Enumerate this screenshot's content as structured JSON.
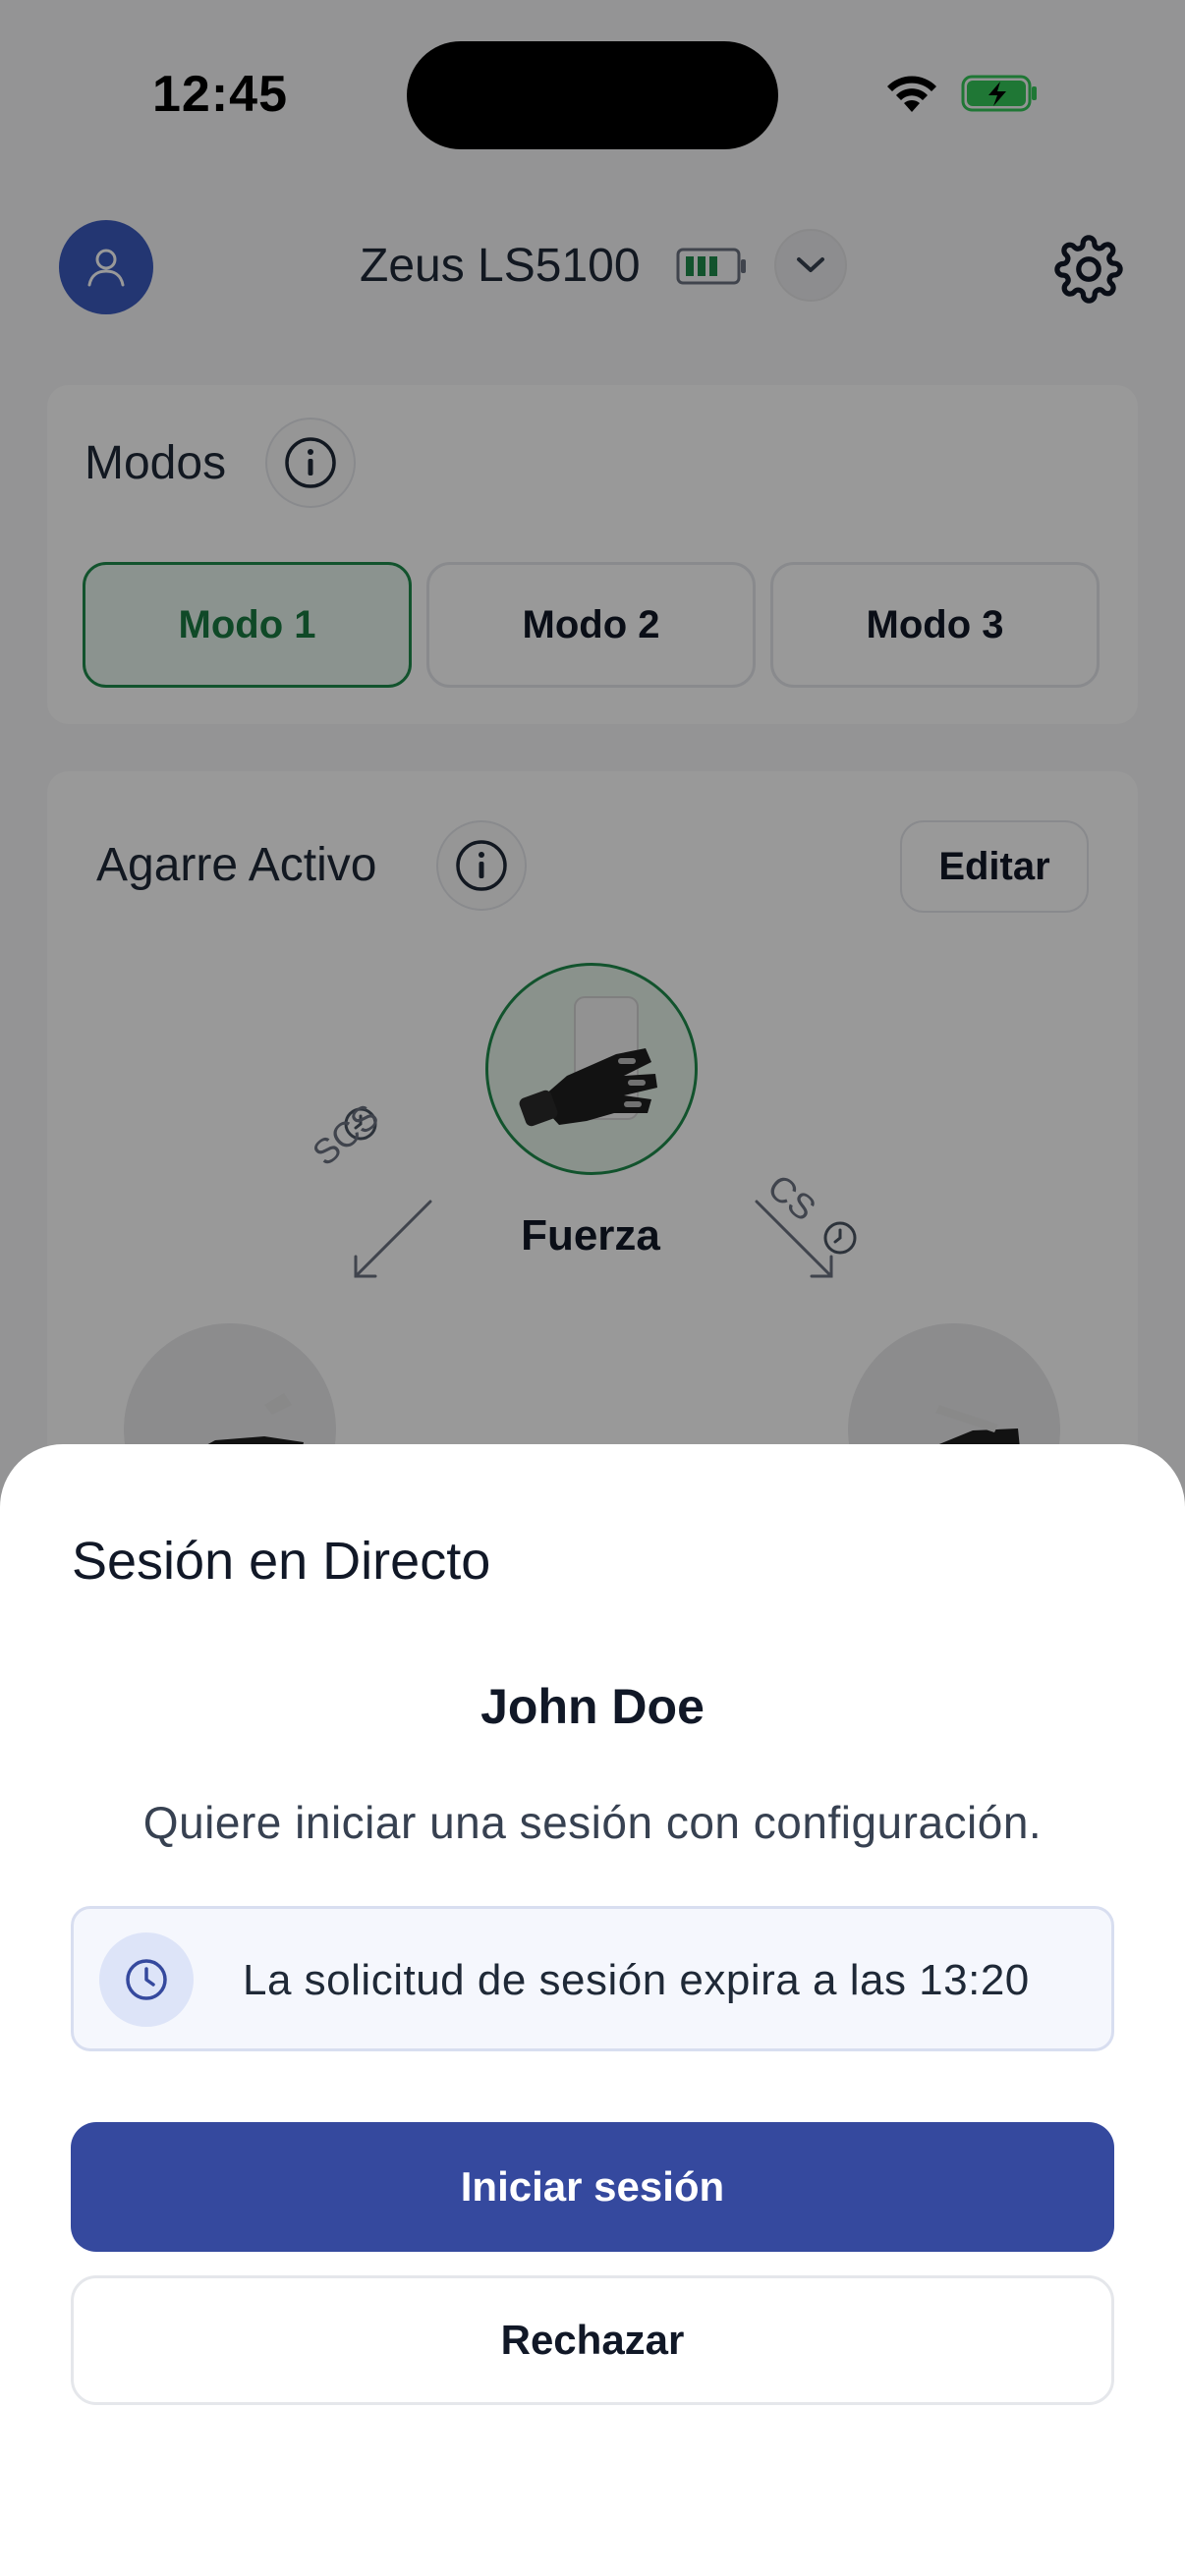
{
  "status_bar": {
    "time": "12:45",
    "wifi_icon": "wifi-icon",
    "battery_icon": "battery-charging-icon"
  },
  "header": {
    "device_name": "Zeus LS5100",
    "avatar_icon": "user-icon",
    "device_battery_icon": "battery-icon",
    "dropdown_icon": "chevron-down-icon",
    "settings_icon": "gear-icon"
  },
  "modes": {
    "title": "Modos",
    "items": [
      {
        "label": "Modo 1",
        "active": true
      },
      {
        "label": "Modo 2",
        "active": false
      },
      {
        "label": "Modo 3",
        "active": false
      }
    ]
  },
  "grip": {
    "title": "Agarre Activo",
    "edit_label": "Editar",
    "active_name": "Fuerza",
    "left_arrow_label": "SCS",
    "right_arrow_label": "CS"
  },
  "sheet": {
    "title": "Sesión en Directo",
    "requester": "John Doe",
    "message": "Quiere iniciar una sesión con configuración.",
    "expiry_notice": "La solicitud de sesión expira a las 13:20",
    "primary_label": "Iniciar sesión",
    "secondary_label": "Rechazar"
  },
  "colors": {
    "accent": "#35499e",
    "active_green": "#1e8a4b",
    "avatar_blue": "#3b5bbf"
  }
}
